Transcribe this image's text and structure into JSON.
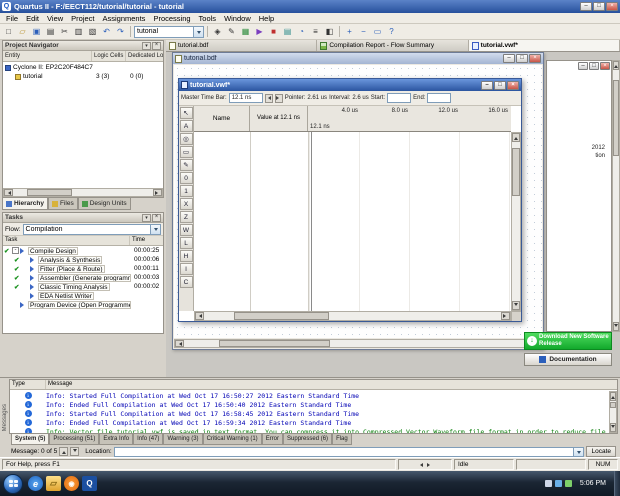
{
  "win_controls": [
    {
      "name": "minimize-button",
      "glyph": "–",
      "cls": "min"
    },
    {
      "name": "maximize-button",
      "glyph": "□",
      "cls": "max"
    },
    {
      "name": "close-button",
      "glyph": "×",
      "cls": "close"
    }
  ],
  "titlebar": {
    "title": "Quartus II - F:/EECT112/tutorial/tutorial - tutorial",
    "app_glyph": "Q"
  },
  "menu": {
    "items": [
      "File",
      "Edit",
      "View",
      "Project",
      "Assignments",
      "Processing",
      "Tools",
      "Window",
      "Help"
    ]
  },
  "toolbar": {
    "combo_value": "tutorial",
    "group1": [
      {
        "name": "new-file-icon",
        "glyph": "□",
        "cls": "ink"
      },
      {
        "name": "open-file-icon",
        "glyph": "▱",
        "cls": "gold"
      },
      {
        "name": "save-icon",
        "glyph": "▣",
        "cls": "blue"
      },
      {
        "name": "print-icon",
        "glyph": "▤",
        "cls": "ink"
      },
      {
        "name": "cut-icon",
        "glyph": "✂",
        "cls": "ink"
      },
      {
        "name": "copy-icon",
        "glyph": "▥",
        "cls": "ink"
      },
      {
        "name": "paste-icon",
        "glyph": "▧",
        "cls": "ink"
      },
      {
        "name": "undo-icon",
        "glyph": "↶",
        "cls": "blue"
      },
      {
        "name": "redo-icon",
        "glyph": "↷",
        "cls": "blue"
      }
    ],
    "group2": [
      {
        "name": "settings-icon",
        "glyph": "◈",
        "cls": "ink"
      },
      {
        "name": "assignment-editor-icon",
        "glyph": "✎",
        "cls": "ink"
      },
      {
        "name": "pin-planner-icon",
        "glyph": "▦",
        "cls": "green"
      },
      {
        "name": "start-compilation-icon",
        "glyph": "▶",
        "cls": "purple"
      },
      {
        "name": "stop-icon",
        "glyph": "■",
        "cls": "red"
      },
      {
        "name": "compilation-report-icon",
        "glyph": "▤",
        "cls": "teal"
      },
      {
        "name": "timing-analyzer-icon",
        "glyph": "◔",
        "cls": "blue"
      },
      {
        "name": "netlist-viewer-icon",
        "glyph": "≡",
        "cls": "ink"
      },
      {
        "name": "programmer-icon",
        "glyph": "◧",
        "cls": "ink"
      }
    ],
    "group3": [
      {
        "name": "zoom-in-icon",
        "glyph": "+",
        "cls": "blue"
      },
      {
        "name": "zoom-out-icon",
        "glyph": "−",
        "cls": "blue"
      },
      {
        "name": "fit-view-icon",
        "glyph": "▭",
        "cls": "blue"
      },
      {
        "name": "help-icon",
        "glyph": "?",
        "cls": "blue"
      }
    ]
  },
  "doc_tabs": [
    {
      "label": "tutorial.bdf",
      "icon": "ic-bdf",
      "state": ""
    },
    {
      "label": "Compilation Report - Flow Summary",
      "icon": "ic-rpt",
      "state": ""
    },
    {
      "label": "tutorial.vwf*",
      "icon": "ic-vwf",
      "state": "active"
    }
  ],
  "project_navigator": {
    "title": "Project Navigator",
    "columns": {
      "entity": "Entity",
      "logic_cells": "Logic Cells",
      "dedicated": "Dedicated Logic"
    },
    "rows": [
      {
        "entity": "Cyclone II: EP2C20F484C7",
        "logic_cells": "",
        "dedicated": "",
        "level": "lv0",
        "icon": "ic-chip"
      },
      {
        "entity": "tutorial",
        "logic_cells": "3 (3)",
        "dedicated": "0 (0)",
        "level": "lv1",
        "icon": "ic-ent"
      }
    ],
    "tabs": [
      {
        "label": "Hierarchy",
        "state": "active",
        "icon": "ti-blue"
      },
      {
        "label": "Files",
        "state": "",
        "icon": "ti-gold"
      },
      {
        "label": "Design Units",
        "state": "",
        "icon": "ti-green"
      }
    ]
  },
  "tasks": {
    "title": "Tasks",
    "flow_label": "Flow:",
    "flow_value": "Compilation",
    "col_task": "Task",
    "col_time": "Time",
    "rows": [
      {
        "check": "✔",
        "expander": "-",
        "label": "Compile Design",
        "time": "00:00:25",
        "level": "lv0"
      },
      {
        "check": "✔",
        "expander": "",
        "label": "Analysis & Synthesis",
        "time": "00:00:06",
        "level": "lv1"
      },
      {
        "check": "✔",
        "expander": "",
        "label": "Fitter (Place & Route)",
        "time": "00:00:11",
        "level": "lv1"
      },
      {
        "check": "✔",
        "expander": "",
        "label": "Assembler (Generate programming files)",
        "time": "00:00:03",
        "level": "lv1"
      },
      {
        "check": "✔",
        "expander": "",
        "label": "Classic Timing Analysis",
        "time": "00:00:02",
        "level": "lv1"
      },
      {
        "check": "",
        "expander": "",
        "label": "EDA Netlist Writer",
        "time": "",
        "level": "lv1"
      },
      {
        "check": "",
        "expander": "",
        "label": "Program Device (Open Programmer)",
        "time": "",
        "level": "lv0"
      }
    ]
  },
  "bdf_window": {
    "title": "tutorial.bdf"
  },
  "waveform": {
    "title": "tutorial.vwf*",
    "master_label": "Master Time Bar:",
    "master_value": "12.1 ns",
    "pointer_label": "Pointer:",
    "pointer_value": "2.61 us",
    "interval_label": "Interval:",
    "interval_value": "2.6 us",
    "start_label": "Start:",
    "end_label": "End:",
    "col_name": "Name",
    "col_value": "Value at 12.1 ns",
    "ticks": [
      "4.0 us",
      "8.0 us",
      "12.0 us",
      "16.0 us"
    ],
    "marker": "12.1 ns",
    "tools": [
      {
        "name": "select-tool-icon",
        "glyph": "↖"
      },
      {
        "name": "text-tool-icon",
        "glyph": "A"
      },
      {
        "name": "zoom-tool-icon",
        "glyph": "◎"
      },
      {
        "name": "full-screen-tool-icon",
        "glyph": "▭"
      },
      {
        "name": "edit-tool-icon",
        "glyph": "✎"
      },
      {
        "name": "value-0-icon",
        "glyph": "0"
      },
      {
        "name": "value-1-icon",
        "glyph": "1"
      },
      {
        "name": "value-x-icon",
        "glyph": "X"
      },
      {
        "name": "value-z-icon",
        "glyph": "Z"
      },
      {
        "name": "value-w-icon",
        "glyph": "W"
      },
      {
        "name": "value-l-icon",
        "glyph": "L"
      },
      {
        "name": "value-h-icon",
        "glyph": "H"
      },
      {
        "name": "invert-value-icon",
        "glyph": "I"
      },
      {
        "name": "count-value-icon",
        "glyph": "C"
      }
    ]
  },
  "report_peek": {
    "fragments": [
      "2012",
      "tion"
    ]
  },
  "promo": {
    "download_label": "Download New Software Release",
    "documentation_label": "Documentation"
  },
  "messages": {
    "side_label": "Messages",
    "col_type": "Type",
    "col_message": "Message",
    "rows": [
      {
        "text": "Info: Started Full Compilation at Wed Oct 17 16:50:27 2012 Eastern Standard Time",
        "color": "c-blue"
      },
      {
        "text": "Info: Ended Full Compilation at Wed Oct 17 16:50:40 2012 Eastern Standard Time",
        "color": "c-blue"
      },
      {
        "text": "Info: Started Full Compilation at Wed Oct 17 16:58:45 2012 Eastern Standard Time",
        "color": "c-blue"
      },
      {
        "text": "Info: Ended Full Compilation at Wed Oct 17 16:59:34 2012 Eastern Standard Time",
        "color": "c-blue"
      },
      {
        "text": "Info: Vector file tutorial.vwf is saved in text format. You can compress it into Compressed Vector Waveform file format in order to reduce file size",
        "color": "c-green"
      }
    ],
    "tabs": [
      {
        "label": "System (5)",
        "state": "active"
      },
      {
        "label": "Processing (51)",
        "state": ""
      },
      {
        "label": "Extra Info",
        "state": ""
      },
      {
        "label": "Info (47)",
        "state": ""
      },
      {
        "label": "Warning (3)",
        "state": ""
      },
      {
        "label": "Critical Warning (1)",
        "state": ""
      },
      {
        "label": "Error",
        "state": ""
      },
      {
        "label": "Suppressed (6)",
        "state": ""
      },
      {
        "label": "Flag",
        "state": ""
      }
    ],
    "counter": "Message: 0 of 5",
    "location_label": "Location:",
    "locate_button": "Locate"
  },
  "statusbar": {
    "help": "For Help, press F1",
    "state": "Idle",
    "num": "NUM"
  },
  "taskbar": {
    "clock": "5:06 PM",
    "quick_launch": [
      {
        "name": "internet-explorer-icon",
        "glyph": "e",
        "cls": "ie"
      },
      {
        "name": "explorer-folder-icon",
        "glyph": "▱",
        "cls": "folder"
      },
      {
        "name": "media-player-icon",
        "glyph": "◉",
        "cls": "media"
      },
      {
        "name": "quartus-taskbar-icon",
        "glyph": "Q",
        "cls": "quartus"
      }
    ]
  }
}
